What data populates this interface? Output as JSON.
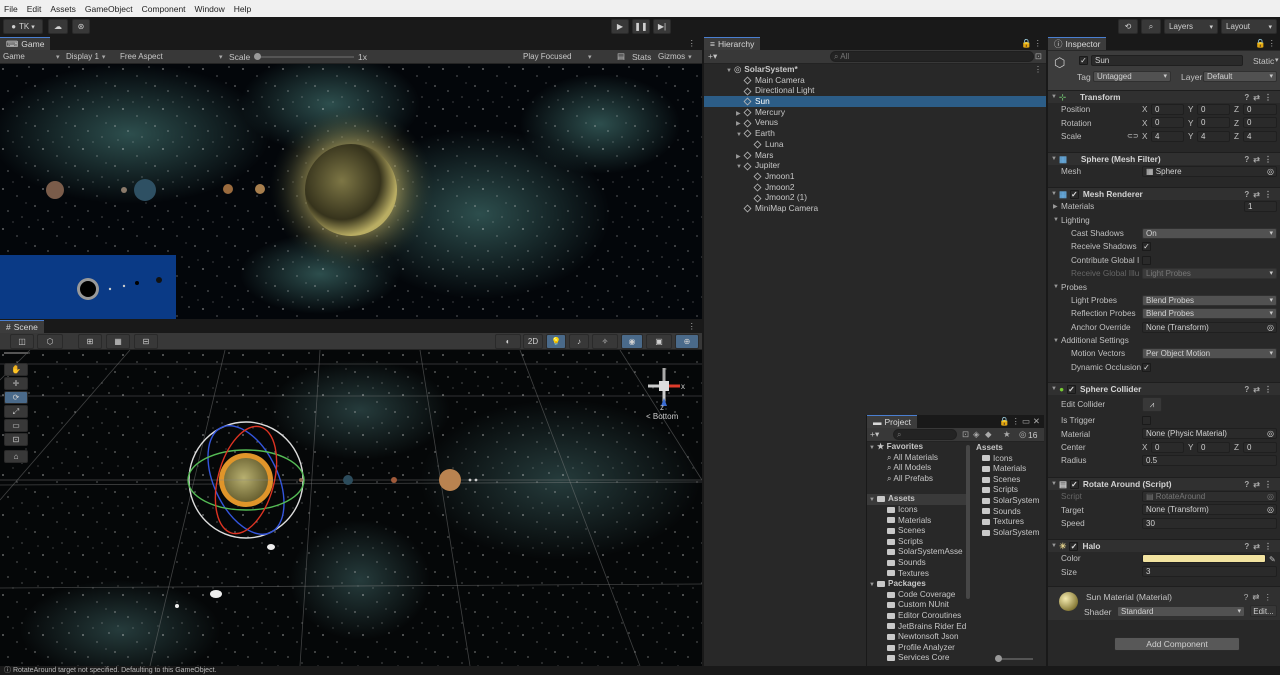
{
  "menu": [
    "File",
    "Edit",
    "Assets",
    "GameObject",
    "Component",
    "Window",
    "Help"
  ],
  "toolbar": {
    "account": "TK",
    "play_icon": "play-icon",
    "pause_icon": "pause-icon",
    "step_icon": "step-icon",
    "layers": "Layers",
    "layout": "Layout"
  },
  "game": {
    "tab": "Game",
    "mode": "Game",
    "display": "Display 1",
    "aspect": "Free Aspect",
    "scale_label": "Scale",
    "scale_value": "1x",
    "play_focused": "Play Focused",
    "stats": "Stats",
    "gizmos": "Gizmos"
  },
  "scene": {
    "tab": "Scene",
    "btn_2d": "2D",
    "gizmo_label": "< Bottom",
    "gizmo_z": "z",
    "gizmo_x": "x"
  },
  "hierarchy": {
    "tab": "Hierarchy",
    "search_placeholder": "All",
    "root": "SolarSystem*",
    "items": [
      {
        "label": "Main Camera",
        "depth": 1,
        "expand": ""
      },
      {
        "label": "Directional Light",
        "depth": 1,
        "expand": ""
      },
      {
        "label": "Sun",
        "depth": 1,
        "expand": "",
        "selected": true
      },
      {
        "label": "Mercury",
        "depth": 1,
        "expand": "▶"
      },
      {
        "label": "Venus",
        "depth": 1,
        "expand": "▶"
      },
      {
        "label": "Earth",
        "depth": 1,
        "expand": "▼"
      },
      {
        "label": "Luna",
        "depth": 2,
        "expand": ""
      },
      {
        "label": "Mars",
        "depth": 1,
        "expand": "▶"
      },
      {
        "label": "Jupiter",
        "depth": 1,
        "expand": "▼"
      },
      {
        "label": "Jmoon1",
        "depth": 2,
        "expand": ""
      },
      {
        "label": "Jmoon2",
        "depth": 2,
        "expand": ""
      },
      {
        "label": "Jmoon2 (1)",
        "depth": 2,
        "expand": ""
      },
      {
        "label": "MiniMap Camera",
        "depth": 1,
        "expand": ""
      }
    ]
  },
  "project": {
    "tab": "Project",
    "count": "16",
    "favorites": {
      "label": "Favorites",
      "items": [
        "All Materials",
        "All Models",
        "All Prefabs"
      ]
    },
    "assets": {
      "label": "Assets",
      "items": [
        "Icons",
        "Materials",
        "Scenes",
        "Scripts",
        "SolarSystemAsse",
        "Sounds",
        "Textures"
      ]
    },
    "packages": {
      "label": "Packages",
      "items": [
        "Code Coverage",
        "Custom NUnit",
        "Editor Coroutines",
        "JetBrains Rider Ed",
        "Newtonsoft Json",
        "Profile Analyzer",
        "Services Core"
      ]
    },
    "right_header": "Assets",
    "right_items": [
      "Icons",
      "Materials",
      "Scenes",
      "Scripts",
      "SolarSystem",
      "Sounds",
      "Textures",
      "SolarSystem"
    ]
  },
  "inspector": {
    "tab": "Inspector",
    "name": "Sun",
    "static": "Static",
    "tag_label": "Tag",
    "tag": "Untagged",
    "layer_label": "Layer",
    "layer": "Default",
    "transform": {
      "title": "Transform",
      "position": {
        "label": "Position",
        "x": "0",
        "y": "0",
        "z": "0"
      },
      "rotation": {
        "label": "Rotation",
        "x": "0",
        "y": "0",
        "z": "0"
      },
      "scale": {
        "label": "Scale",
        "x": "4",
        "y": "4",
        "z": "4"
      }
    },
    "mesh_filter": {
      "title": "Sphere (Mesh Filter)",
      "mesh_label": "Mesh",
      "mesh": "Sphere"
    },
    "mesh_renderer": {
      "title": "Mesh Renderer",
      "materials_label": "Materials",
      "materials_count": "1",
      "lighting": "Lighting",
      "cast_shadows_label": "Cast Shadows",
      "cast_shadows": "On",
      "receive_shadows_label": "Receive Shadows",
      "contribute_gi_label": "Contribute Global I",
      "receive_gi_label": "Receive Global Illu",
      "receive_gi": "Light Probes",
      "probes": "Probes",
      "light_probes_label": "Light Probes",
      "light_probes": "Blend Probes",
      "reflection_probes_label": "Reflection Probes",
      "reflection_probes": "Blend Probes",
      "anchor_label": "Anchor Override",
      "anchor": "None (Transform)",
      "additional": "Additional Settings",
      "motion_label": "Motion Vectors",
      "motion": "Per Object Motion",
      "occlusion_label": "Dynamic Occlusion"
    },
    "sphere_collider": {
      "title": "Sphere Collider",
      "edit_label": "Edit Collider",
      "trigger_label": "Is Trigger",
      "material_label": "Material",
      "material": "None (Physic Material)",
      "center_label": "Center",
      "cx": "0",
      "cy": "0",
      "cz": "0",
      "radius_label": "Radius",
      "radius": "0.5"
    },
    "rotate": {
      "title": "Rotate Around (Script)",
      "script_label": "Script",
      "script": "RotateAround",
      "target_label": "Target",
      "target": "None (Transform)",
      "speed_label": "Speed",
      "speed": "30"
    },
    "halo": {
      "title": "Halo",
      "color_label": "Color",
      "color": "#f2e3a0",
      "size_label": "Size",
      "size": "3"
    },
    "material": {
      "title": "Sun Material (Material)",
      "shader_label": "Shader",
      "shader": "Standard",
      "edit": "Edit..."
    },
    "add_component": "Add Component"
  },
  "status": "RotateAround target not specified. Defaulting to this GameObject."
}
